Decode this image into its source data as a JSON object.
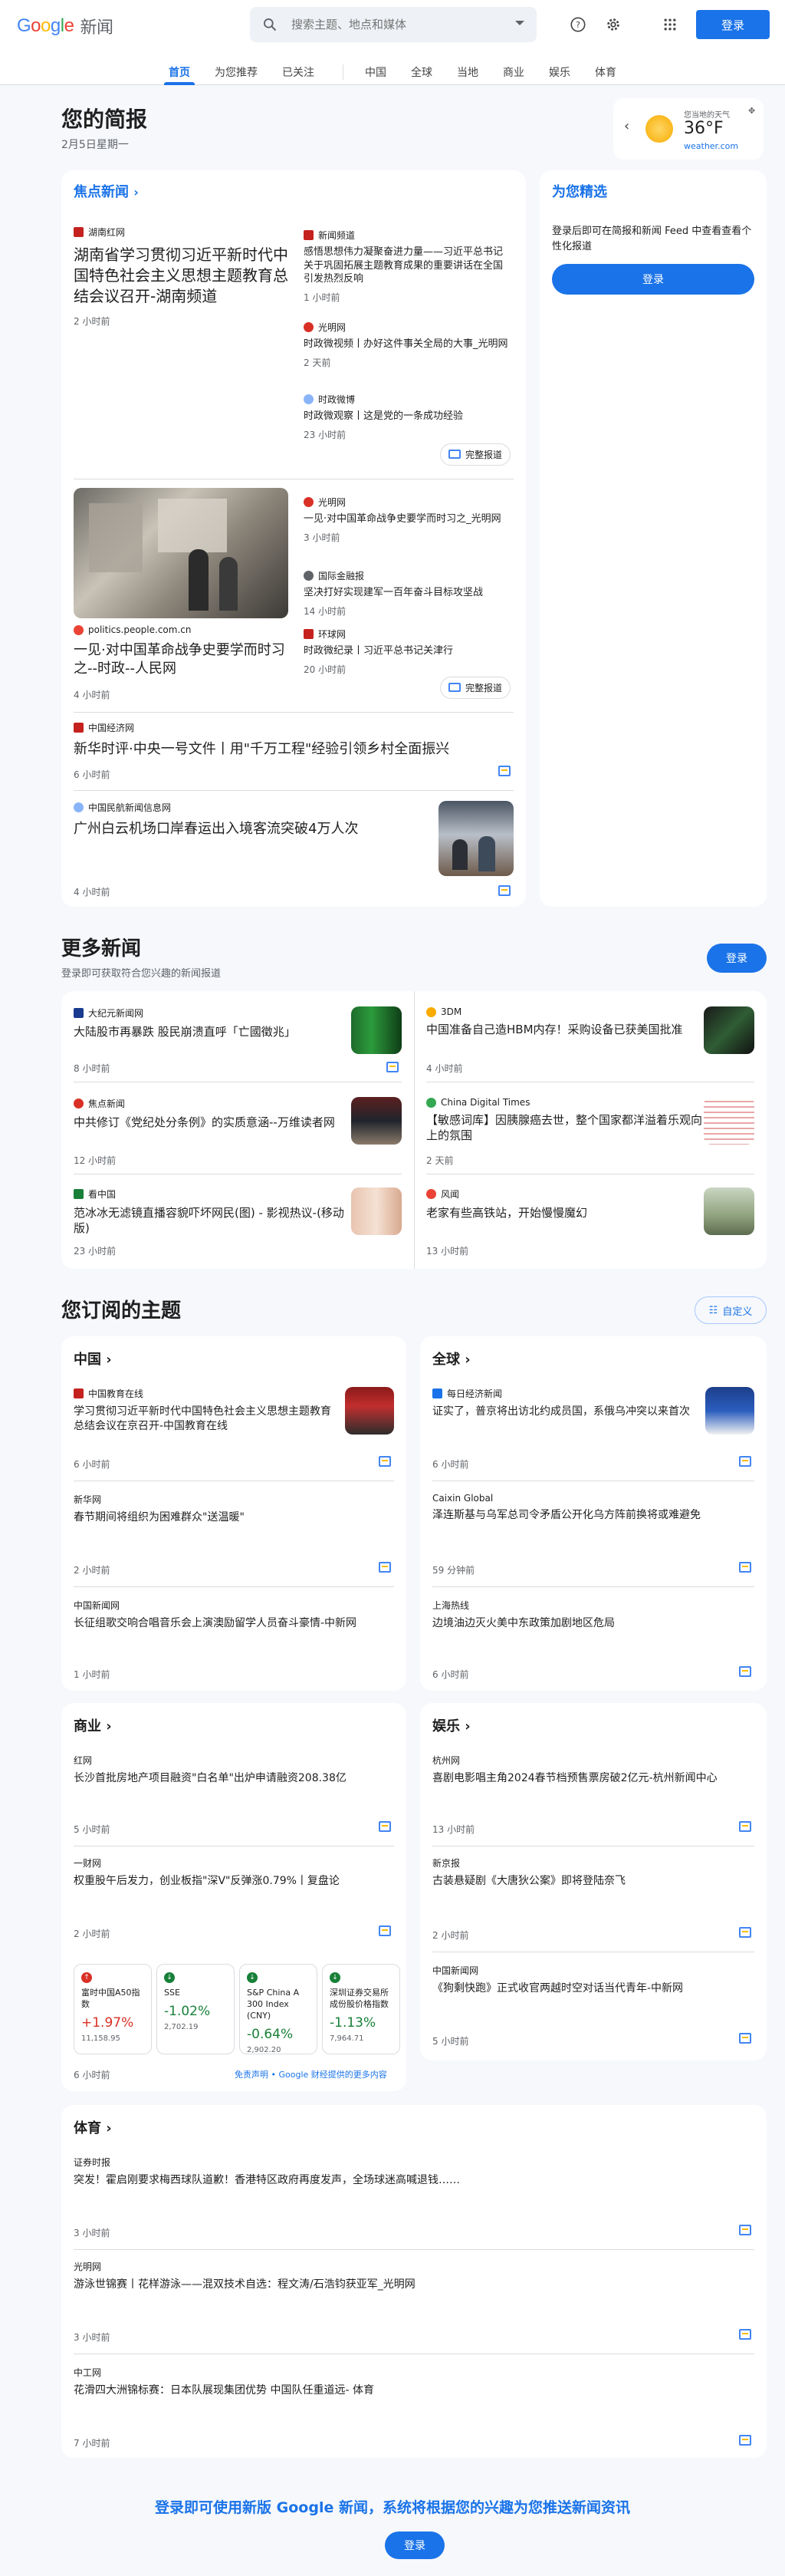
{
  "header": {
    "logo_google": "Google",
    "logo_news": "新闻",
    "search_placeholder": "搜索主题、地点和媒体",
    "signin": "登录"
  },
  "nav": {
    "tabs": [
      "首页",
      "为您推荐",
      "已关注",
      "中国",
      "全球",
      "当地",
      "商业",
      "娱乐",
      "体育"
    ]
  },
  "briefing": {
    "title": "您的简报",
    "date": "2月5日星期一",
    "weather_label": "您当地的天气",
    "weather_temp": "36°F",
    "weather_source": "weather.com"
  },
  "top_stories": {
    "title": "焦点新闻",
    "full_coverage": "完整报道",
    "cluster1": {
      "main": {
        "source": "湖南红网",
        "headline": "湖南省学习贯彻习近平新时代中国特色社会主义思想主题教育总结会议召开-湖南频道",
        "time": "2 小时前"
      },
      "side": [
        {
          "source": "新闻频道",
          "headline": "感悟思想伟力凝聚奋进力量——习近平总书记关于巩固拓展主题教育成果的重要讲话在全国引发热烈反响",
          "time": "1 小时前"
        },
        {
          "source": "光明网",
          "headline": "时政微视频丨办好这件事关全局的大事_光明网",
          "time": "2 天前"
        },
        {
          "source": "时政微博",
          "headline": "时政微观察丨这是党的一条成功经验",
          "time": "23 小时前"
        }
      ]
    },
    "cluster2": {
      "main": {
        "source": "politics.people.com.cn",
        "headline": "一见·对中国革命战争史要学而时习之--时政--人民网",
        "time": "4 小时前"
      },
      "side": [
        {
          "source": "光明网",
          "headline": "一见·对中国革命战争史要学而时习之_光明网",
          "time": "3 小时前"
        },
        {
          "source": "国际金融报",
          "headline": "坚决打好实现建军一百年奋斗目标攻坚战",
          "time": "14 小时前"
        },
        {
          "source": "环球网",
          "headline": "时政微纪录丨习近平总书记关津行",
          "time": "20 小时前"
        }
      ]
    },
    "single1": {
      "source": "中国经济网",
      "headline": "新华时评·中央一号文件丨用\"千万工程\"经验引领乡村全面振兴",
      "time": "6 小时前"
    },
    "single2": {
      "source": "中国民航新闻信息网",
      "headline": "广州白云机场口岸春运出入境客流突破4万人次",
      "time": "4 小时前"
    }
  },
  "picks": {
    "title": "为您精选",
    "text": "登录后即可在简报和新闻 Feed 中查看查看个性化报道",
    "button": "登录"
  },
  "more_news": {
    "title": "更多新闻",
    "subtitle": "登录即可获取符合您兴趣的新闻报道",
    "signin": "登录",
    "items": [
      {
        "source": "大纪元新闻网",
        "headline": "大陆股市再暴跌 股民崩溃直呼「亡國徵兆」",
        "time": "8 小时前"
      },
      {
        "source": "3DM",
        "headline": "中国准备自己造HBM内存！采购设备已获美国批准",
        "time": "4 小时前"
      },
      {
        "source": "焦点新闻",
        "headline": "中共修订《党纪处分条例》的实质意涵--万维读者网",
        "time": "12 小时前"
      },
      {
        "source": "China Digital Times",
        "headline": "【敏感词库】因胰腺癌去世，整个国家都洋溢着乐观向上的氛围",
        "time": "2 天前"
      },
      {
        "source": "看中国",
        "headline": "范冰冰无滤镜直播容貌吓坏网民(图) - 影视热议-(移动版)",
        "time": "23 小时前"
      },
      {
        "source": "风闻",
        "headline": "老家有些高铁站，开始慢慢魔幻",
        "time": "13 小时前"
      }
    ]
  },
  "topics": {
    "title": "您订阅的主题",
    "customize": "自定义",
    "china": {
      "title": "中国",
      "items": [
        {
          "source": "中国教育在线",
          "headline": "学习贯彻习近平新时代中国特色社会主义思想主题教育总结会议在京召开-中国教育在线",
          "time": "6 小时前"
        },
        {
          "source": "新华网",
          "headline": "春节期间将组织为困难群众\"送温暖\"",
          "time": "2 小时前"
        },
        {
          "source": "中国新闻网",
          "headline": "长征组歌交响合唱音乐会上演澳励留学人员奋斗豪情-中新网",
          "time": "1 小时前"
        }
      ]
    },
    "world": {
      "title": "全球",
      "items": [
        {
          "source": "每日经济新闻",
          "headline": "证实了，普京将出访北约成员国，系俄乌冲突以来首次",
          "time": "6 小时前"
        },
        {
          "source": "Caixin Global",
          "headline": "泽连斯基与乌军总司令矛盾公开化乌方阵前换将或难避免",
          "time": "59 分钟前"
        },
        {
          "source": "上海热线",
          "headline": "边境油边灭火美中东政策加剧地区危局",
          "time": "6 小时前"
        }
      ]
    },
    "business": {
      "title": "商业",
      "items": [
        {
          "source": "红网",
          "headline": "长沙首批房地产项目融资\"白名单\"出炉申请融资208.38亿",
          "time": "5 小时前"
        },
        {
          "source": "一财网",
          "headline": "权重股午后发力，创业板指\"深V\"反弹涨0.79%丨复盘论",
          "time": "2 小时前"
        }
      ],
      "markets": [
        {
          "name": "富时中国A50指数",
          "change": "+1.97%",
          "value": "11,158.95",
          "dir": "up"
        },
        {
          "name": "SSE",
          "change": "-1.02%",
          "value": "2,702.19",
          "dir": "down"
        },
        {
          "name": "S&P China A 300 Index (CNY)",
          "change": "-0.64%",
          "value": "2,902.20",
          "dir": "down"
        },
        {
          "name": "深圳证券交易所成份股价格指数",
          "change": "-1.13%",
          "value": "7,964.71",
          "dir": "down"
        }
      ],
      "market_time": "6 小时前",
      "disclaimer": "免责声明 • Google 财经提供的更多内容"
    },
    "ent": {
      "title": "娱乐",
      "items": [
        {
          "source": "杭州网",
          "headline": "喜剧电影唱主角2024春节档预售票房破2亿元-杭州新闻中心",
          "time": "13 小时前"
        },
        {
          "source": "新京报",
          "headline": "古装悬疑剧《大唐狄公案》即将登陆奈飞",
          "time": "2 小时前"
        },
        {
          "source": "中国新闻网",
          "headline": "《狗剩快跑》正式收官两越时空对话当代青年-中新网",
          "time": "5 小时前"
        }
      ]
    },
    "sports": {
      "title": "体育",
      "items": [
        {
          "source": "证券时报",
          "headline": "突发！霍启刚要求梅西球队道歉！香港特区政府再度发声，全场球迷高喊退钱……",
          "time": "3 小时前"
        },
        {
          "source": "光明网",
          "headline": "游泳世锦赛丨花样游泳——混双技术自选：程文涛/石浩钧获亚军_光明网",
          "time": "3 小时前"
        },
        {
          "source": "中工网",
          "headline": "花滑四大洲锦标赛：日本队展现集团优势 中国队任重道远- 体育",
          "time": "7 小时前"
        }
      ]
    }
  },
  "footer": {
    "text": "登录即可使用新版 Google 新闻，系统将根据您的兴趣为您推送新闻资讯",
    "button": "登录"
  },
  "colors": {
    "blue": "#1a73e8",
    "red": "#d93025",
    "green": "#188038"
  }
}
